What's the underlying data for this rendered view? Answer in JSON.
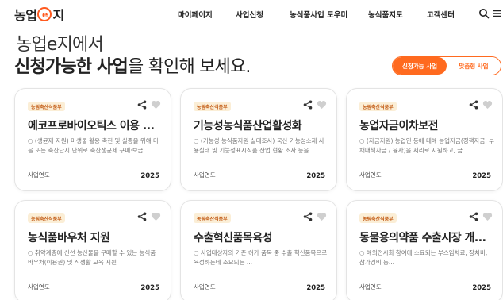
{
  "header": {
    "logo": {
      "part1": "농업",
      "mid": "e",
      "part2": "지"
    },
    "nav": [
      "마이페이지",
      "사업신청",
      "농식품사업 도우미",
      "농식품지도",
      "고객센터"
    ],
    "icons": [
      "search-icon",
      "menu-icon"
    ]
  },
  "hero": {
    "line1": "농업e지에서",
    "line2_bold": "신청가능한 사업",
    "line2_rest": "을 확인해 보세요."
  },
  "toggle": {
    "active": "신청가능 사업",
    "inactive": "맞춤형 사업"
  },
  "colors": {
    "accent": "#ff6a1f",
    "badge_bg": "#fbeed6",
    "badge_text": "#c25a13"
  },
  "cards": [
    {
      "badge": "농림축산식품부",
      "title": "에코프로바이오틱스 이용 ...",
      "desc": "○ (생균제 지원) 미생물 활용 축진 및 실증을 위해 마을 또는 축산단지 단위로 축산생균제 구매·보급...",
      "year_label": "사업연도",
      "year": "2025"
    },
    {
      "badge": "농림축산식품부",
      "title": "기능성농식품산업활성화",
      "desc": "○ (기능성 농식품자원 실태조사) 국산 기능성소재 사용실태 및 기능성표시식품 산업 현황 조사 등을...",
      "year_label": "사업연도",
      "year": "2025"
    },
    {
      "badge": "농림축산식품부",
      "title": "농업자금이차보전",
      "desc": "○ (자금지원) 농업인 등에 대해 농업자금(정책자금, 부채대책자금 / 융자)을 저리로 지원하고, 금...",
      "year_label": "사업연도",
      "year": "2025"
    },
    {
      "badge": "농림축산식품부",
      "title": "농식품바우처 지원",
      "desc": "○ 취약계층에 신선 농산물을 구매할 수 있는 농식품 바우처(이용권) 및 식생활 교육 지원",
      "year_label": "사업연도",
      "year": "2025"
    },
    {
      "badge": "농림축산식품부",
      "title": "수출혁신품목육성",
      "desc": "○ 사업대상자의 기존 허가 품목 중 수출 혁신품목으로 육성하는데 소요되는 ...",
      "year_label": "사업연도",
      "year": "2025"
    },
    {
      "badge": "농림축산식품부",
      "title": "동물용의약품 수출시장 개...",
      "desc": "○ 해외전시회 참여에 소요되는 부스임차료, 장치비, 참가경비 등...",
      "year_label": "사업연도",
      "year": "2025"
    }
  ]
}
